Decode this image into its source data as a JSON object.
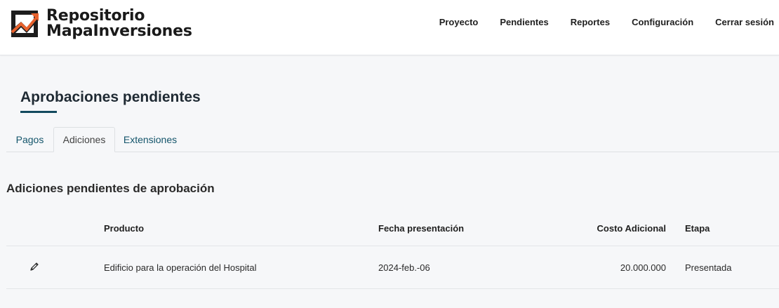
{
  "brand": {
    "line1": "Repositorio",
    "line2": "MapaInversiones"
  },
  "nav": [
    {
      "label": "Proyecto"
    },
    {
      "label": "Pendientes"
    },
    {
      "label": "Reportes"
    },
    {
      "label": "Configuración"
    },
    {
      "label": "Cerrar sesión"
    }
  ],
  "page": {
    "title": "Aprobaciones pendientes"
  },
  "tabs": [
    {
      "label": "Pagos",
      "active": false
    },
    {
      "label": "Adiciones",
      "active": true
    },
    {
      "label": "Extensiones",
      "active": false
    }
  ],
  "section": {
    "title": "Adiciones pendientes de aprobación"
  },
  "table": {
    "columns": [
      "Producto",
      "Fecha presentación",
      "Costo Adicional",
      "Etapa"
    ],
    "rows": [
      {
        "producto": "Edificio para la operación del Hospital",
        "fecha": "2024-feb.-06",
        "costo": "20.000.000",
        "etapa": "Presentada",
        "action_icon": "pencil-icon"
      }
    ]
  },
  "colors": {
    "accent": "#124a5e",
    "tab_link": "#14556b",
    "logo_orange": "#e8612c"
  }
}
